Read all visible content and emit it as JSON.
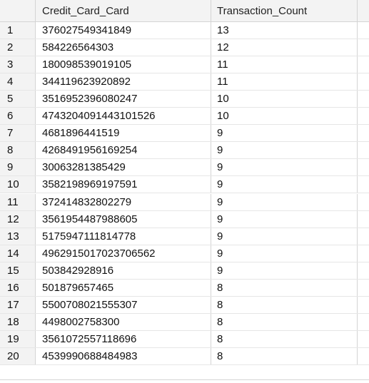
{
  "grid": {
    "columns": [
      "Credit_Card_Card",
      "Transaction_Count"
    ],
    "rows": [
      {
        "num": "1",
        "card": "376027549341849",
        "count": "13"
      },
      {
        "num": "2",
        "card": "584226564303",
        "count": "12"
      },
      {
        "num": "3",
        "card": "180098539019105",
        "count": "11"
      },
      {
        "num": "4",
        "card": "344119623920892",
        "count": "11"
      },
      {
        "num": "5",
        "card": "3516952396080247",
        "count": "10"
      },
      {
        "num": "6",
        "card": "4743204091443101526",
        "count": "10"
      },
      {
        "num": "7",
        "card": "4681896441519",
        "count": "9"
      },
      {
        "num": "8",
        "card": "4268491956169254",
        "count": "9"
      },
      {
        "num": "9",
        "card": "30063281385429",
        "count": "9"
      },
      {
        "num": "10",
        "card": "3582198969197591",
        "count": "9"
      },
      {
        "num": "11",
        "card": "372414832802279",
        "count": "9"
      },
      {
        "num": "12",
        "card": "3561954487988605",
        "count": "9"
      },
      {
        "num": "13",
        "card": "5175947111814778",
        "count": "9"
      },
      {
        "num": "14",
        "card": "4962915017023706562",
        "count": "9"
      },
      {
        "num": "15",
        "card": "503842928916",
        "count": "9"
      },
      {
        "num": "16",
        "card": "501879657465",
        "count": "8"
      },
      {
        "num": "17",
        "card": "5500708021555307",
        "count": "8"
      },
      {
        "num": "18",
        "card": "4498002758300",
        "count": "8"
      },
      {
        "num": "19",
        "card": "3561072557118696",
        "count": "8"
      },
      {
        "num": "20",
        "card": "4539990688484983",
        "count": "8"
      }
    ]
  }
}
